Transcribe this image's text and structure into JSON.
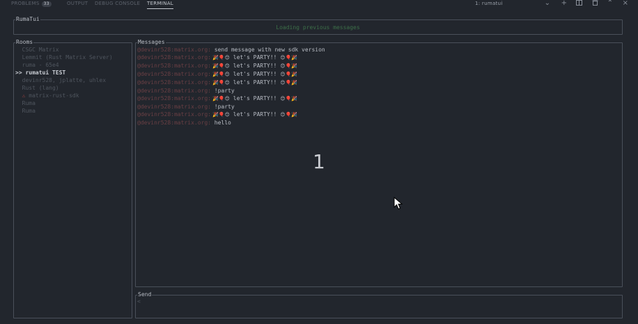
{
  "panel_tabs": [
    {
      "label": "PROBLEMS",
      "badge": "33"
    },
    {
      "label": "OUTPUT"
    },
    {
      "label": "DEBUG CONSOLE"
    },
    {
      "label": "TERMINAL"
    }
  ],
  "terminal_select": "1: rumatui",
  "icons": [
    "chevron-down-icon",
    "plus-icon",
    "split-icon",
    "trash-icon",
    "chevron-up-icon",
    "close-icon"
  ],
  "app_title": "RumaTui",
  "status_text": "Loading previous messages",
  "rooms": {
    "title": "Rooms",
    "items": [
      {
        "label": "  CSGC Matrix"
      },
      {
        "label": "  Lemmit (Rust Matrix Server)"
      },
      {
        "label": "  ruma - 65e4"
      },
      {
        "mark": ">> ",
        "label": "rumatui TEST",
        "selected": true
      },
      {
        "label": "  devinr528, jplatte, uhlex"
      },
      {
        "label": "  Rust (lang)"
      },
      {
        "warn": "  ⚠ ",
        "label": "matrix-rust-sdk"
      },
      {
        "label": "  Ruma"
      },
      {
        "label": "  Ruma"
      }
    ]
  },
  "messages": {
    "title": "Messages",
    "items": [
      {
        "sender": "@devinr528:matrix.org:",
        "body": " send message with new sdk version"
      },
      {
        "sender": "@devinr528:matrix.org:",
        "emoji_pre": " 🎉🎈😊",
        "body": " let's PARTY!! ",
        "emoji_post": "😊🎈🎉"
      },
      {
        "sender": "@devinr528:matrix.org:",
        "emoji_pre": " 🎉🎈😊",
        "body": " let's PARTY!! ",
        "emoji_post": "😊🎈🎉"
      },
      {
        "sender": "@devinr528:matrix.org:",
        "emoji_pre": " 🎉🎈😊",
        "body": " let's PARTY!! ",
        "emoji_post": "😊🎈🎉"
      },
      {
        "sender": "@devinr528:matrix.org:",
        "emoji_pre": " 🎉🎈😊",
        "body": " let's PARTY!! ",
        "emoji_post": "😊🎈🎉"
      },
      {
        "sender": "@devinr528:matrix.org:",
        "body": " !party"
      },
      {
        "sender": "@devinr528:matrix.org:",
        "emoji_pre": " 🎉🎈😊",
        "body": " let's PARTY!! ",
        "emoji_post": "😊🎈🎉"
      },
      {
        "sender": "@devinr528:matrix.org:",
        "body": " !party"
      },
      {
        "sender": "@devinr528:matrix.org:",
        "emoji_pre": " 🎉🎈😊",
        "body": " let's PARTY!! ",
        "emoji_post": "😊🎈🎉"
      },
      {
        "sender": "@devinr528:matrix.org:",
        "body": " hello"
      }
    ]
  },
  "send": {
    "title": "Send",
    "prompt": "<"
  },
  "overlay_number": "1"
}
